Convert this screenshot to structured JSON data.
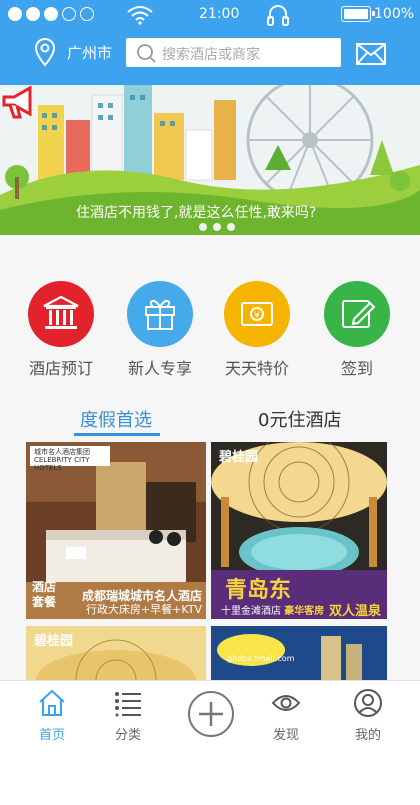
{
  "status_bar": {
    "time": "21:00",
    "battery": "100%",
    "battery_level": 1.0,
    "signal_dots_filled": 3,
    "signal_dots_total": 5
  },
  "header": {
    "city": "广州市",
    "search_placeholder": "搜索酒店或商家"
  },
  "banner": {
    "text": "住酒店不用钱了,就是这么任性,敢来吗?",
    "page_count": 3
  },
  "quick_menu": [
    {
      "label": "酒店预订",
      "icon": "bank-icon",
      "color": "#e2232b"
    },
    {
      "label": "新人专享",
      "icon": "gift-icon",
      "color": "#45a9ea"
    },
    {
      "label": "天天特价",
      "icon": "coupon-icon",
      "color": "#f5b400"
    },
    {
      "label": "签到",
      "icon": "edit-icon",
      "color": "#38b449"
    }
  ],
  "tabs": [
    {
      "label": "度假首选",
      "active": true
    },
    {
      "label": "0元住酒店",
      "active": false
    }
  ],
  "deals": [
    {
      "logo_cn": "城市名人酒店集团",
      "logo_en": "CELEBRITY CITY HOTELS",
      "tag": "酒店套餐",
      "title": "成都瑞城城市名人酒店",
      "subtitle": "行政大床房+早餐+KTV"
    },
    {
      "brand": "碧桂园",
      "headline": "青岛东",
      "subtitle_left": "十里金滩酒店",
      "subtitle_mid": "豪华客房",
      "highlight": "双人温泉"
    },
    {
      "brand": "碧桂园"
    },
    {
      "logo_text": "ghdpx.tmall.com"
    }
  ],
  "nav": [
    {
      "label": "首页",
      "icon": "home-icon",
      "active": true
    },
    {
      "label": "分类",
      "icon": "list-icon",
      "active": false
    },
    {
      "label": "",
      "icon": "add-icon",
      "active": false
    },
    {
      "label": "发现",
      "icon": "eye-icon",
      "active": false
    },
    {
      "label": "我的",
      "icon": "user-icon",
      "active": false
    }
  ],
  "colors": {
    "primary": "#3ea3ee",
    "tab_active": "#3a8fd8",
    "background": "#f6f6f6"
  }
}
